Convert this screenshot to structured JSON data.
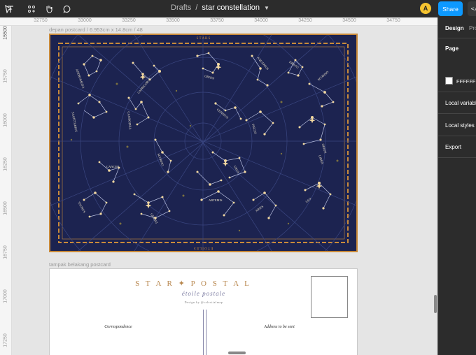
{
  "toolbar": {
    "breadcrumb_parent": "Drafts",
    "breadcrumb_separator": "/",
    "file_title": "star constellation",
    "avatar_initial": "A",
    "share_label": "Share",
    "code_label": "</>"
  },
  "rulers": {
    "top": [
      "32750",
      "33000",
      "33250",
      "33500",
      "33750",
      "34000",
      "34250",
      "34500",
      "34750"
    ],
    "left": [
      "15750",
      "16000",
      "16250",
      "16500",
      "16750",
      "17000",
      "17250"
    ],
    "left_highlight": "15500"
  },
  "canvas": {
    "front_frame_label": "depan postcard / 6.953cm x 14.8cm / 48",
    "back_frame_label": "tampak belakang postcard",
    "starmap": {
      "header": "S T A R S",
      "footer": "É T O I L E S",
      "colors": {
        "navy": "#1c2350",
        "gold": "#c98a3a",
        "star": "#f4d9a0"
      },
      "constellations": [
        "ANDROMEDA",
        "CAPRICORNE",
        "ORION",
        "AQUARIUS",
        "SCORPIO",
        "SAGITTARIUS",
        "CASSIOPEIA",
        "CEPHEUS",
        "PISCES",
        "SCORPIO",
        "ORION",
        "URSA",
        "CANCER",
        "LIBRA",
        "ARTEMIS",
        "LEO",
        "GEMINI",
        "TAURUS",
        "ARIES",
        "DRACO"
      ]
    },
    "postcard_back": {
      "title": "S T A R  ✦  P O S T A L",
      "subtitle": "étoile postale",
      "credit": "Design by @celestialmap",
      "correspondence_label": "Correspondence",
      "address_label": "Address to be sent"
    }
  },
  "panel": {
    "tab_design": "Design",
    "tab_prototype": "Pro",
    "page_heading": "Page",
    "page_color": "FFFFFF",
    "local_variables": "Local variables",
    "local_styles": "Local styles",
    "export": "Export"
  }
}
